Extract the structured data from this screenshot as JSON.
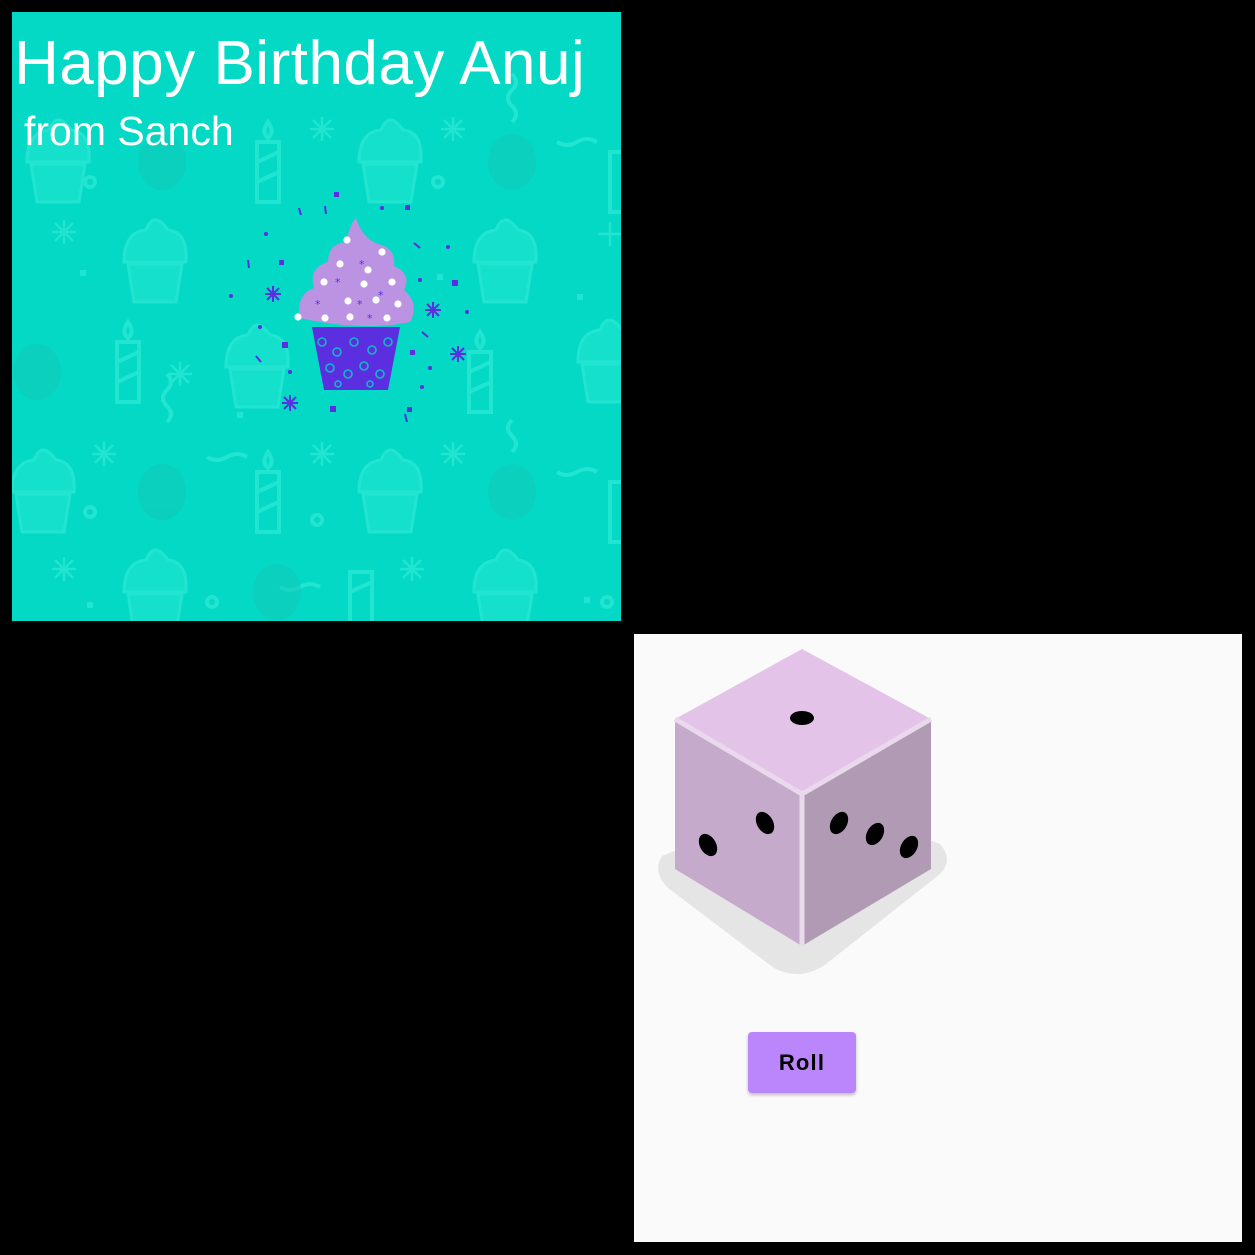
{
  "birthday_card": {
    "greeting": "Happy Birthday Anuj",
    "signature": "from Sanch",
    "background_color": "#03d9c5",
    "illustration_icon": "cupcake-icon"
  },
  "dice_roller": {
    "die_icon": "die-icon",
    "roll_label": "Roll",
    "button_color": "#bb86fc",
    "panel_background": "#fafafa"
  }
}
